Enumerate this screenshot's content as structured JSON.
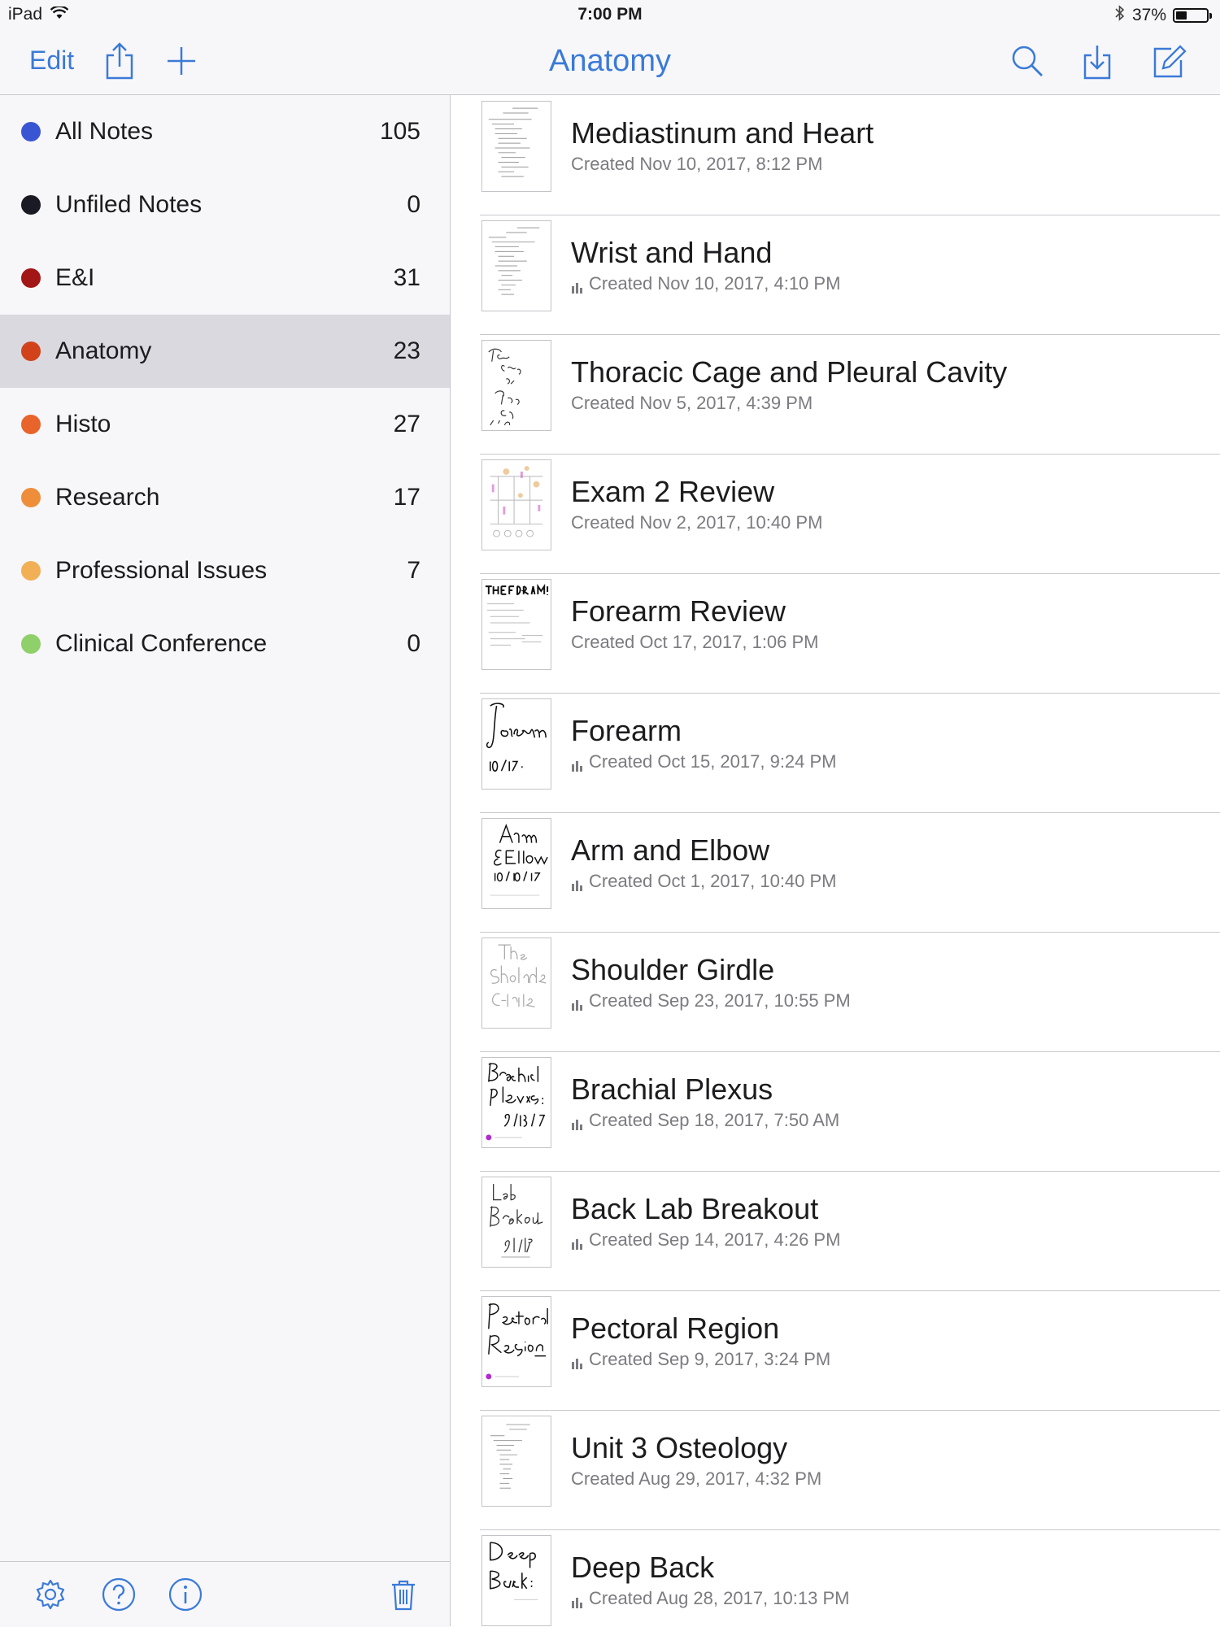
{
  "status": {
    "device": "iPad",
    "time": "7:00 PM",
    "battery": "37%"
  },
  "nav": {
    "edit_label": "Edit",
    "title": "Anatomy"
  },
  "folders": [
    {
      "name": "All Notes",
      "count": "105",
      "color": "#3a55d4",
      "selected": false
    },
    {
      "name": "Unfiled Notes",
      "count": "0",
      "color": "#1a1a24",
      "selected": false
    },
    {
      "name": "E&I",
      "count": "31",
      "color": "#a31616",
      "selected": false
    },
    {
      "name": "Anatomy",
      "count": "23",
      "color": "#d2421a",
      "selected": true
    },
    {
      "name": "Histo",
      "count": "27",
      "color": "#e8642a",
      "selected": false
    },
    {
      "name": "Research",
      "count": "17",
      "color": "#ee8e3a",
      "selected": false
    },
    {
      "name": "Professional Issues",
      "count": "7",
      "color": "#f2b056",
      "selected": false
    },
    {
      "name": "Clinical Conference",
      "count": "0",
      "color": "#8fd06a",
      "selected": false
    }
  ],
  "notes": [
    {
      "title": "Mediastinum and Heart",
      "date": "Created Nov 10, 2017, 8:12 PM",
      "audio": false,
      "thumb": "text-doc"
    },
    {
      "title": "Wrist and Hand",
      "date": "Created Nov 10, 2017, 4:10 PM",
      "audio": true,
      "thumb": "text-doc"
    },
    {
      "title": "Thoracic Cage and Pleural Cavity",
      "date": "Created Nov 5, 2017, 4:39 PM",
      "audio": false,
      "thumb": "handwritten-title"
    },
    {
      "title": "Exam 2 Review",
      "date": "Created Nov 2, 2017, 10:40 PM",
      "audio": false,
      "thumb": "diagram"
    },
    {
      "title": "Forearm Review",
      "date": "Created Oct 17, 2017, 1:06 PM",
      "audio": false,
      "thumb": "forearm-review"
    },
    {
      "title": "Forearm",
      "date": "Created Oct 15, 2017, 9:24 PM",
      "audio": true,
      "thumb": "handwritten-title"
    },
    {
      "title": "Arm and Elbow",
      "date": "Created Oct 1, 2017, 10:40 PM",
      "audio": true,
      "thumb": "handwritten-title"
    },
    {
      "title": "Shoulder Girdle",
      "date": "Created Sep 23, 2017, 10:55 PM",
      "audio": true,
      "thumb": "handwritten-light"
    },
    {
      "title": "Brachial Plexus",
      "date": "Created Sep 18, 2017, 7:50 AM",
      "audio": true,
      "thumb": "handwritten-title"
    },
    {
      "title": "Back Lab Breakout",
      "date": "Created Sep 14, 2017, 4:26 PM",
      "audio": true,
      "thumb": "handwritten-title"
    },
    {
      "title": "Pectoral Region",
      "date": "Created Sep 9, 2017, 3:24 PM",
      "audio": true,
      "thumb": "handwritten-title"
    },
    {
      "title": "Unit 3 Osteology",
      "date": "Created Aug 29, 2017, 4:32 PM",
      "audio": false,
      "thumb": "text-doc"
    },
    {
      "title": "Deep Back",
      "date": "Created Aug 28, 2017, 10:13 PM",
      "audio": true,
      "thumb": "handwritten-title"
    }
  ],
  "colors": {
    "accent": "#3b7ad8",
    "selected_row": "#d9d9df"
  }
}
